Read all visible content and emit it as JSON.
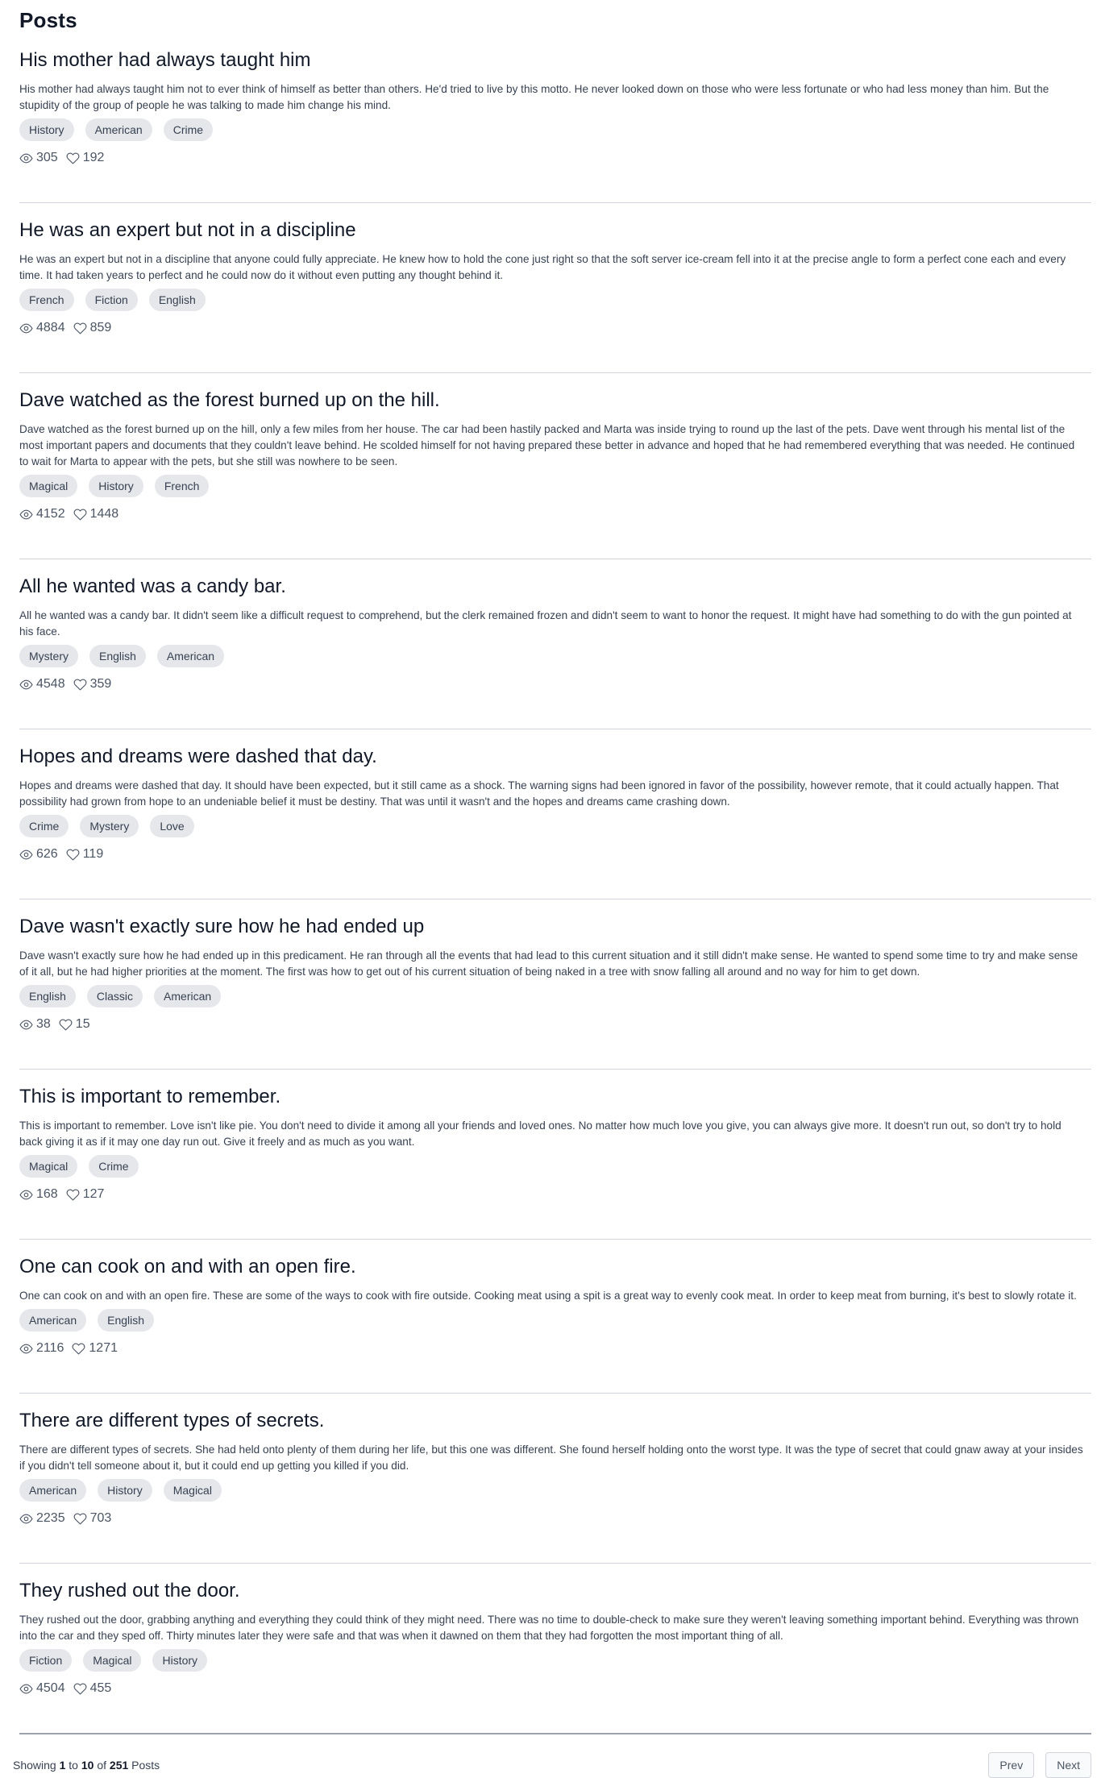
{
  "header": {
    "title": "Posts"
  },
  "posts": [
    {
      "title": "His mother had always taught him",
      "body": "His mother had always taught him not to ever think of himself as better than others. He'd tried to live by this motto. He never looked down on those who were less fortunate or who had less money than him. But the stupidity of the group of people he was talking to made him change his mind.",
      "tags": [
        "History",
        "American",
        "Crime"
      ],
      "views": "305",
      "likes": "192"
    },
    {
      "title": "He was an expert but not in a discipline",
      "body": "He was an expert but not in a discipline that anyone could fully appreciate. He knew how to hold the cone just right so that the soft server ice-cream fell into it at the precise angle to form a perfect cone each and every time. It had taken years to perfect and he could now do it without even putting any thought behind it.",
      "tags": [
        "French",
        "Fiction",
        "English"
      ],
      "views": "4884",
      "likes": "859"
    },
    {
      "title": "Dave watched as the forest burned up on the hill.",
      "body": "Dave watched as the forest burned up on the hill, only a few miles from her house. The car had been hastily packed and Marta was inside trying to round up the last of the pets. Dave went through his mental list of the most important papers and documents that they couldn't leave behind. He scolded himself for not having prepared these better in advance and hoped that he had remembered everything that was needed. He continued to wait for Marta to appear with the pets, but she still was nowhere to be seen.",
      "tags": [
        "Magical",
        "History",
        "French"
      ],
      "views": "4152",
      "likes": "1448"
    },
    {
      "title": "All he wanted was a candy bar.",
      "body": "All he wanted was a candy bar. It didn't seem like a difficult request to comprehend, but the clerk remained frozen and didn't seem to want to honor the request. It might have had something to do with the gun pointed at his face.",
      "tags": [
        "Mystery",
        "English",
        "American"
      ],
      "views": "4548",
      "likes": "359"
    },
    {
      "title": "Hopes and dreams were dashed that day.",
      "body": "Hopes and dreams were dashed that day. It should have been expected, but it still came as a shock. The warning signs had been ignored in favor of the possibility, however remote, that it could actually happen. That possibility had grown from hope to an undeniable belief it must be destiny. That was until it wasn't and the hopes and dreams came crashing down.",
      "tags": [
        "Crime",
        "Mystery",
        "Love"
      ],
      "views": "626",
      "likes": "119"
    },
    {
      "title": "Dave wasn't exactly sure how he had ended up",
      "body": "Dave wasn't exactly sure how he had ended up in this predicament. He ran through all the events that had lead to this current situation and it still didn't make sense. He wanted to spend some time to try and make sense of it all, but he had higher priorities at the moment. The first was how to get out of his current situation of being naked in a tree with snow falling all around and no way for him to get down.",
      "tags": [
        "English",
        "Classic",
        "American"
      ],
      "views": "38",
      "likes": "15"
    },
    {
      "title": "This is important to remember.",
      "body": "This is important to remember. Love isn't like pie. You don't need to divide it among all your friends and loved ones. No matter how much love you give, you can always give more. It doesn't run out, so don't try to hold back giving it as if it may one day run out. Give it freely and as much as you want.",
      "tags": [
        "Magical",
        "Crime"
      ],
      "views": "168",
      "likes": "127"
    },
    {
      "title": "One can cook on and with an open fire.",
      "body": "One can cook on and with an open fire. These are some of the ways to cook with fire outside. Cooking meat using a spit is a great way to evenly cook meat. In order to keep meat from burning, it's best to slowly rotate it.",
      "tags": [
        "American",
        "English"
      ],
      "views": "2116",
      "likes": "1271"
    },
    {
      "title": "There are different types of secrets.",
      "body": "There are different types of secrets. She had held onto plenty of them during her life, but this one was different. She found herself holding onto the worst type. It was the type of secret that could gnaw away at your insides if you didn't tell someone about it, but it could end up getting you killed if you did.",
      "tags": [
        "American",
        "History",
        "Magical"
      ],
      "views": "2235",
      "likes": "703"
    },
    {
      "title": "They rushed out the door.",
      "body": "They rushed out the door, grabbing anything and everything they could think of they might need. There was no time to double-check to make sure they weren't leaving something important behind. Everything was thrown into the car and they sped off. Thirty minutes later they were safe and that was when it dawned on them that they had forgotten the most important thing of all.",
      "tags": [
        "Fiction",
        "Magical",
        "History"
      ],
      "views": "4504",
      "likes": "455"
    }
  ],
  "footer": {
    "showing_label": "Showing",
    "from": "1",
    "to_label": "to",
    "to": "10",
    "of_label": "of",
    "total": "251",
    "items_label": "Posts",
    "prev_label": "Prev",
    "next_label": "Next"
  },
  "icons": {
    "views": "eye-icon",
    "likes": "heart-icon"
  },
  "colors": {
    "tag_bg": "#e5e7eb",
    "divider": "#d1d5db",
    "text": "#111827"
  }
}
